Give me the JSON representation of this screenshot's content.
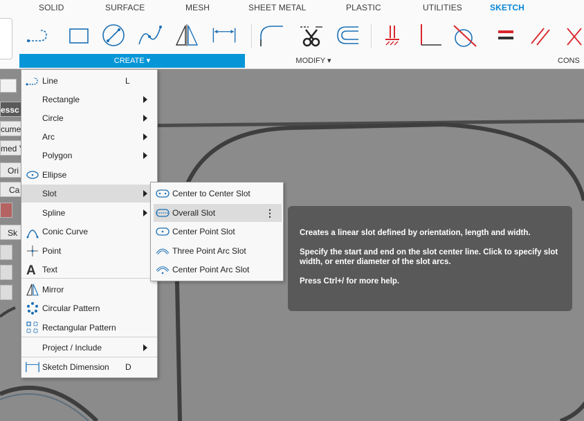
{
  "tabs": [
    "SOLID",
    "SURFACE",
    "MESH",
    "SHEET METAL",
    "PLASTIC",
    "UTILITIES",
    "SKETCH"
  ],
  "active_tab": "SKETCH",
  "groups": {
    "create": "CREATE",
    "modify": "MODIFY",
    "constraints": "CONS"
  },
  "left_panel": [
    "essc",
    "cume",
    "med Y",
    "Ori",
    "Ca",
    "Sk"
  ],
  "create_menu": [
    {
      "label": "Line",
      "shortcut": "L",
      "icon": "line-icon"
    },
    {
      "label": "Rectangle",
      "icon": "none"
    },
    {
      "label": "Circle",
      "icon": "none"
    },
    {
      "label": "Arc",
      "icon": "none"
    },
    {
      "label": "Polygon",
      "icon": "none"
    },
    {
      "label": "Ellipse",
      "icon": "ellipse-icon"
    },
    {
      "label": "Slot",
      "icon": "none"
    },
    {
      "label": "Spline",
      "icon": "none"
    },
    {
      "label": "Conic Curve",
      "icon": "conic-curve-icon"
    },
    {
      "label": "Point",
      "icon": "point-icon"
    },
    {
      "label": "Text",
      "icon": "text-icon"
    },
    {
      "label": "Mirror",
      "icon": "mirror-icon"
    },
    {
      "label": "Circular Pattern",
      "icon": "circular-pattern-icon"
    },
    {
      "label": "Rectangular Pattern",
      "icon": "rectangular-pattern-icon"
    },
    {
      "label": "Project / Include",
      "icon": "none"
    },
    {
      "label": "Sketch Dimension",
      "shortcut": "D",
      "icon": "sketch-dimension-icon"
    }
  ],
  "slot_menu": [
    {
      "label": "Center to Center Slot",
      "icon": "center-to-center-slot-icon"
    },
    {
      "label": "Overall Slot",
      "icon": "overall-slot-icon"
    },
    {
      "label": "Center Point Slot",
      "icon": "center-point-slot-icon"
    },
    {
      "label": "Three Point Arc Slot",
      "icon": "three-point-arc-slot-icon"
    },
    {
      "label": "Center Point Arc Slot",
      "icon": "center-point-arc-slot-icon"
    }
  ],
  "tooltip": {
    "description": "Creates a linear slot defined by orientation, length and width.",
    "instructions": "Specify the start and end on the slot center line. Click to specify slot width, or enter diameter of the slot arcs.",
    "help": "Press Ctrl+/ for more help."
  },
  "colors": {
    "accent": "#0696d7",
    "sketch_red": "#d9262c",
    "tooltip_bg": "#595959"
  }
}
